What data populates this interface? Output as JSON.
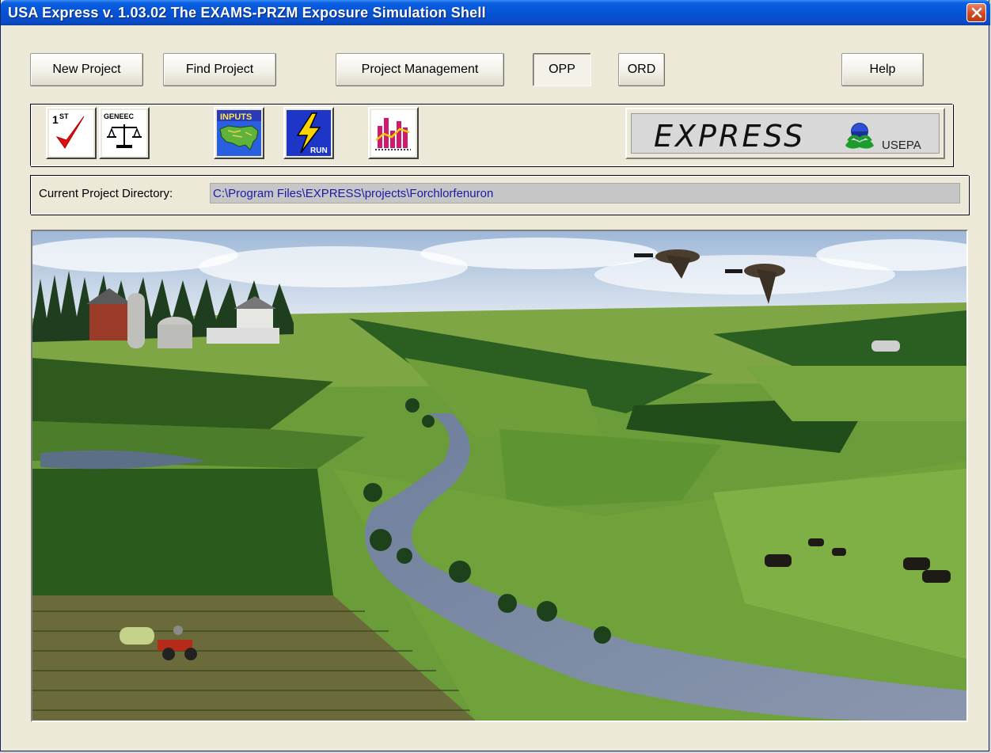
{
  "window": {
    "title": "USA Express v. 1.03.02 The EXAMS-PRZM Exposure Simulation Shell",
    "close_icon": "close-icon"
  },
  "buttons": {
    "new_project": "New Project",
    "find_project": "Find Project",
    "project_management": "Project Management",
    "opp": "OPP",
    "ord": "ORD",
    "help": "Help"
  },
  "toolbar": {
    "icons": [
      {
        "name": "first-tier-checkmark-icon",
        "label": "1ST"
      },
      {
        "name": "geneec-scale-icon",
        "label": "GENEEC"
      },
      {
        "name": "inputs-map-icon",
        "label": "INPUTS"
      },
      {
        "name": "run-lightning-icon",
        "label": "RUN"
      },
      {
        "name": "results-chart-icon",
        "label": ""
      }
    ],
    "logo": {
      "text": "EXPRESS",
      "agency": "USEPA"
    }
  },
  "project": {
    "directory_label": "Current Project Directory:",
    "directory_value": "C:\\Program Files\\EXPRESS\\projects\\Forchlorfenuron"
  },
  "colors": {
    "title_bar": "#0553d6",
    "window_bg": "#ece9d8",
    "directory_text": "#1a1aa8",
    "close_button": "#cf4a25"
  }
}
